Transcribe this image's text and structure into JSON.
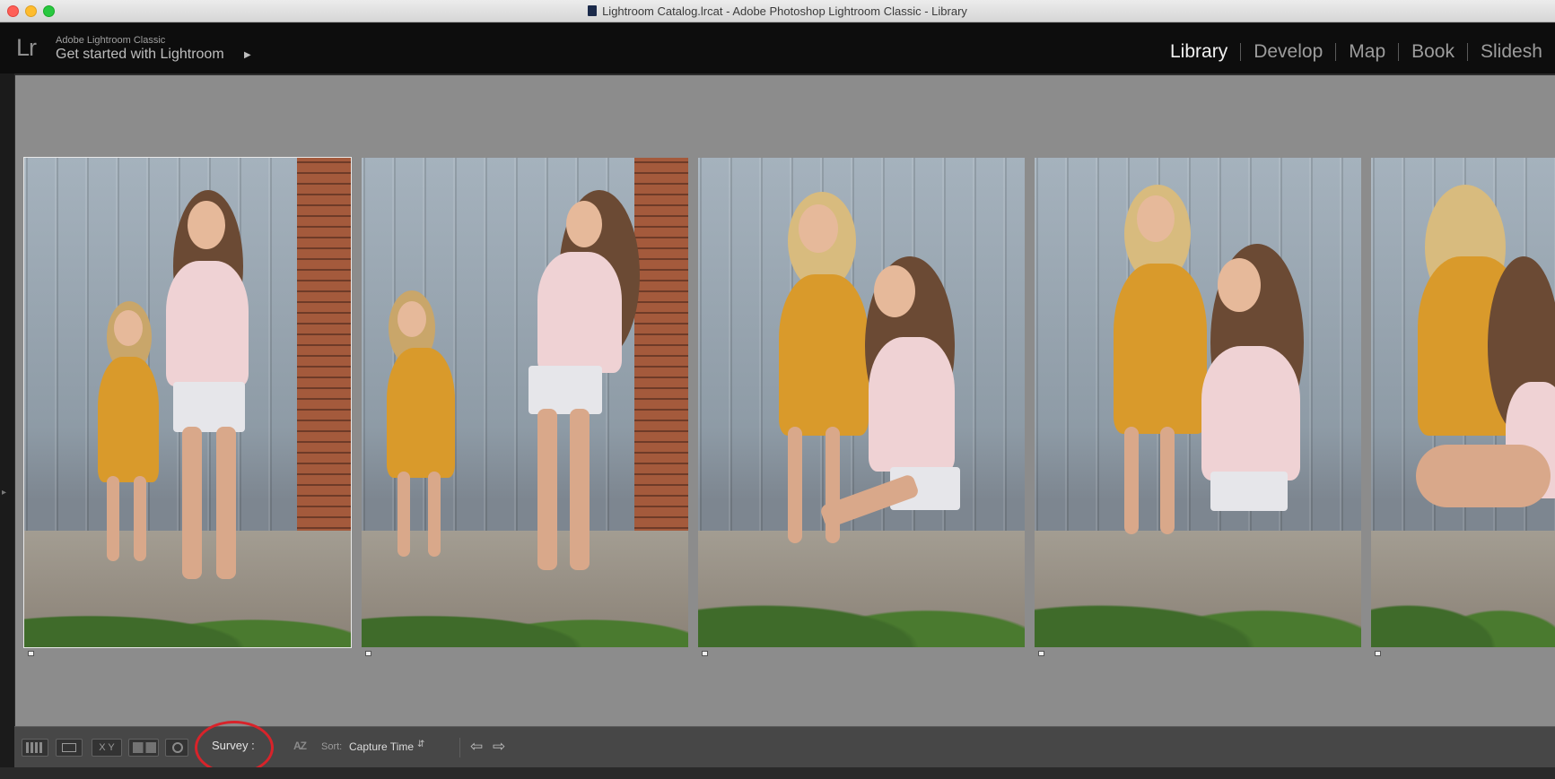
{
  "window": {
    "title": "Lightroom Catalog.lrcat - Adobe Photoshop Lightroom Classic - Library"
  },
  "identity": {
    "logo": "Lr",
    "small": "Adobe Lightroom Classic",
    "main": "Get started with Lightroom"
  },
  "modules": [
    {
      "label": "Library",
      "active": true
    },
    {
      "label": "Develop"
    },
    {
      "label": "Map"
    },
    {
      "label": "Book"
    },
    {
      "label": "Slidesh"
    }
  ],
  "photos": [
    {
      "subject": "mother and daughter standing by barn door",
      "selected": true
    },
    {
      "subject": "mother and daughter holding hands"
    },
    {
      "subject": "mother kneeling with daughter"
    },
    {
      "subject": "mother looking up at daughter"
    },
    {
      "subject": "daughter hugging mother (partially visible)"
    }
  ],
  "toolbar": {
    "view_mode": "Survey :",
    "sort_label": "Sort:",
    "sort_value": "Capture Time",
    "compare_label": "X Y",
    "sort_az": "AZ"
  },
  "colors": {
    "annotation_ring": "#d8232a",
    "background": "#8c8c8c"
  }
}
